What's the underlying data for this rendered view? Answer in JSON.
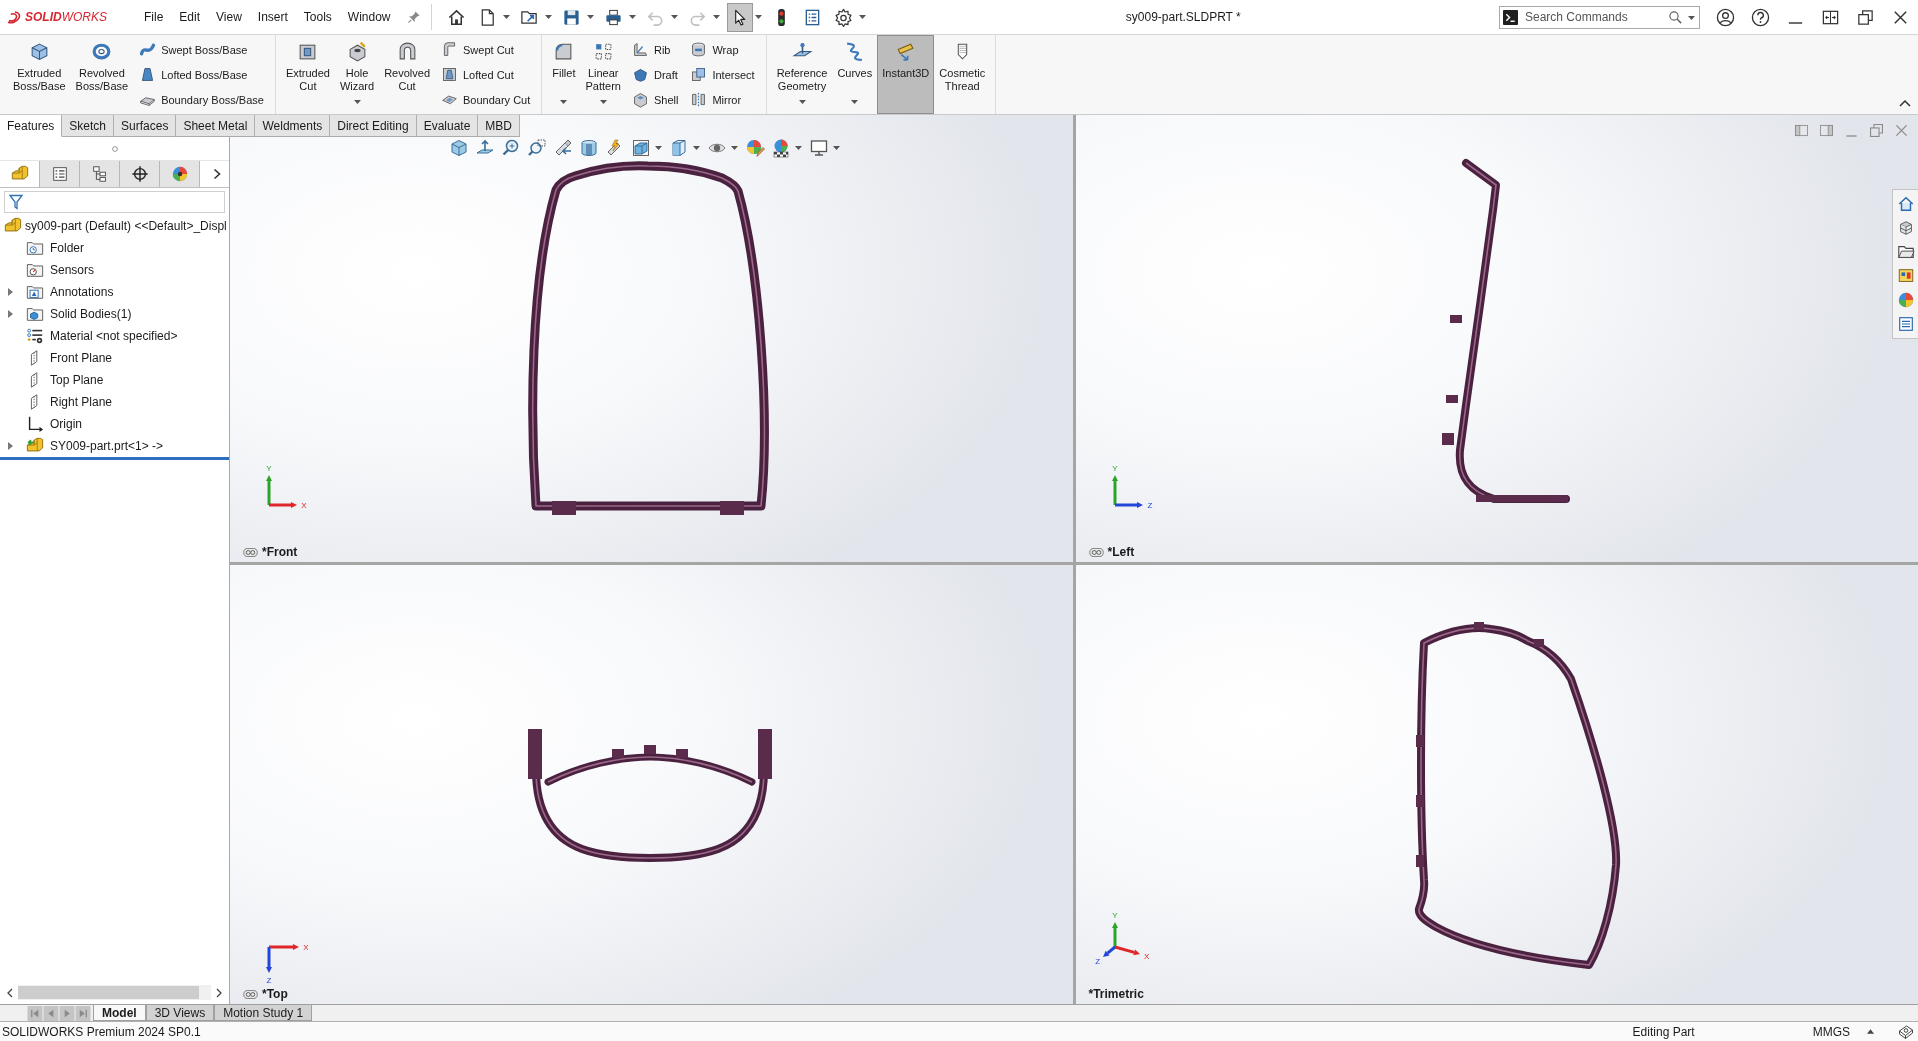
{
  "app": {
    "logo": "**SOLID**WORKS",
    "menu": [
      "File",
      "Edit",
      "View",
      "Insert",
      "Tools",
      "Window"
    ],
    "quick_access": [
      {
        "selected": false,
        "disabled": false,
        "dropdown": false
      },
      {
        "selected": false,
        "disabled": false,
        "dropdown": true
      },
      {
        "selected": false,
        "disabled": false,
        "dropdown": true
      },
      {
        "selected": false,
        "disabled": false,
        "dropdown": true
      },
      {
        "selected": false,
        "disabled": false,
        "dropdown": true
      },
      {
        "selected": false,
        "disabled": true,
        "dropdown": true
      },
      {
        "selected": false,
        "disabled": true,
        "dropdown": true
      },
      {
        "selected": true,
        "disabled": false,
        "dropdown": true
      },
      {
        "selected": false,
        "disabled": false,
        "dropdown": false
      },
      {
        "selected": false,
        "disabled": false,
        "dropdown": false
      },
      {
        "selected": false,
        "disabled": false,
        "dropdown": true
      }
    ],
    "document_title": "sy009-part.SLDPRT *",
    "search": {
      "placeholder": "Search Commands"
    }
  },
  "ribbon": {
    "groups": [
      {
        "columns": [
          {
            "kind": "large",
            "items": [
              {
                "label": "Extruded Boss/Base",
                "dropdown": false,
                "selected": false
              }
            ]
          },
          {
            "kind": "large",
            "items": [
              {
                "label": "Revolved Boss/Base",
                "dropdown": false,
                "selected": false
              }
            ]
          },
          {
            "kind": "stack",
            "items": [
              {
                "label": "Swept Boss/Base",
                "selected": false
              },
              {
                "label": "Lofted Boss/Base",
                "selected": false
              },
              {
                "label": "Boundary Boss/Base",
                "selected": false
              }
            ]
          }
        ]
      },
      {
        "columns": [
          {
            "kind": "large",
            "items": [
              {
                "label": "Extruded Cut",
                "dropdown": false,
                "selected": false
              }
            ]
          },
          {
            "kind": "large",
            "items": [
              {
                "label": "Hole Wizard",
                "dropdown": true,
                "selected": false
              }
            ]
          },
          {
            "kind": "large",
            "items": [
              {
                "label": "Revolved Cut",
                "dropdown": false,
                "selected": false
              }
            ]
          },
          {
            "kind": "stack",
            "items": [
              {
                "label": "Swept Cut",
                "selected": false
              },
              {
                "label": "Lofted Cut",
                "selected": false
              },
              {
                "label": "Boundary Cut",
                "selected": false
              }
            ]
          }
        ]
      },
      {
        "columns": [
          {
            "kind": "large",
            "items": [
              {
                "label": "Fillet",
                "dropdown": true,
                "selected": false
              }
            ]
          },
          {
            "kind": "large",
            "items": [
              {
                "label": "Linear Pattern",
                "dropdown": true,
                "selected": false
              }
            ]
          },
          {
            "kind": "stack",
            "items": [
              {
                "label": "Rib",
                "selected": false
              },
              {
                "label": "Draft",
                "selected": false
              },
              {
                "label": "Shell",
                "selected": false
              }
            ]
          },
          {
            "kind": "stack",
            "items": [
              {
                "label": "Wrap",
                "selected": false
              },
              {
                "label": "Intersect",
                "selected": false
              },
              {
                "label": "Mirror",
                "selected": false
              }
            ]
          }
        ]
      },
      {
        "columns": [
          {
            "kind": "large",
            "items": [
              {
                "label": "Reference Geometry",
                "dropdown": true,
                "selected": false
              }
            ]
          },
          {
            "kind": "large",
            "items": [
              {
                "label": "Curves",
                "dropdown": true,
                "selected": false
              }
            ]
          },
          {
            "kind": "large",
            "items": [
              {
                "label": "Instant3D",
                "dropdown": false,
                "selected": true
              }
            ]
          },
          {
            "kind": "large",
            "items": [
              {
                "label": "Cosmetic Thread",
                "dropdown": false,
                "selected": false
              }
            ]
          }
        ]
      }
    ]
  },
  "command_tabs": [
    {
      "label": "Features",
      "selected": true
    },
    {
      "label": "Sketch",
      "selected": false
    },
    {
      "label": "Surfaces",
      "selected": false
    },
    {
      "label": "Sheet Metal",
      "selected": false
    },
    {
      "label": "Weldments",
      "selected": false
    },
    {
      "label": "Direct Editing",
      "selected": false
    },
    {
      "label": "Evaluate",
      "selected": false
    },
    {
      "label": "MBD",
      "selected": false
    }
  ],
  "feature_manager": {
    "panel_tabs": [
      {
        "selected": true
      },
      {
        "selected": false
      },
      {
        "selected": false
      },
      {
        "selected": false
      },
      {
        "selected": false
      }
    ],
    "tree": {
      "label": "sy009-part (Default) <<Default>_Displ",
      "kind": "part",
      "children": [
        {
          "label": "Folder",
          "kind": "folder",
          "expandable": false,
          "expanded": false
        },
        {
          "label": "Sensors",
          "kind": "sensors",
          "expandable": false,
          "expanded": false
        },
        {
          "label": "Annotations",
          "kind": "annotations",
          "expandable": true,
          "expanded": false
        },
        {
          "label": "Solid Bodies(1)",
          "kind": "bodies",
          "expandable": true,
          "expanded": false
        },
        {
          "label": "Material <not specified>",
          "kind": "material",
          "expandable": false,
          "expanded": false
        },
        {
          "label": "Front Plane",
          "kind": "plane",
          "expandable": false,
          "expanded": false
        },
        {
          "label": "Top Plane",
          "kind": "plane",
          "expandable": false,
          "expanded": false
        },
        {
          "label": "Right Plane",
          "kind": "plane",
          "expandable": false,
          "expanded": false
        },
        {
          "label": "Origin",
          "kind": "origin",
          "expandable": false,
          "expanded": false
        },
        {
          "label": "SY009-part.prt<1> ->",
          "kind": "reference",
          "expandable": true,
          "expanded": false
        }
      ]
    }
  },
  "view_toolbar": [
    {
      "dropdown": false
    },
    {
      "dropdown": false
    },
    {
      "dropdown": false
    },
    {
      "dropdown": false
    },
    {
      "dropdown": false
    },
    {
      "dropdown": false
    },
    {
      "dropdown": false
    },
    {
      "dropdown": true
    },
    {
      "dropdown": true
    },
    {
      "dropdown": true
    },
    {
      "dropdown": false
    },
    {
      "dropdown": true
    },
    {
      "dropdown": true
    }
  ],
  "viewports": [
    {
      "label": "*Front",
      "kind": "front",
      "linked": true,
      "triad": [
        {
          "label": "Y",
          "color": "#2aa52a"
        },
        {
          "label": "X",
          "color": "#e0262a"
        }
      ]
    },
    {
      "label": "*Top",
      "kind": "top",
      "linked": true,
      "triad": [
        {
          "label": "X",
          "color": "#e0262a"
        },
        {
          "label": "Z",
          "color": "#2446d8"
        }
      ]
    },
    {
      "label": "*Left",
      "kind": "left",
      "linked": true,
      "triad": [
        {
          "label": "Y",
          "color": "#2aa52a"
        },
        {
          "label": "Z",
          "color": "#2446d8"
        }
      ]
    },
    {
      "label": "*Trimetric",
      "kind": "trimetric",
      "linked": false,
      "triad": [
        {
          "label": "Y",
          "color": "#2aa52a"
        },
        {
          "label": "X",
          "color": "#e0262a"
        },
        {
          "label": "Z",
          "color": "#2446d8"
        }
      ]
    }
  ],
  "bottom_tabs": [
    {
      "label": "Model",
      "selected": true
    },
    {
      "label": "3D Views",
      "selected": false
    },
    {
      "label": "Motion Study 1",
      "selected": false
    }
  ],
  "status_bar": {
    "product": "SOLIDWORKS Premium 2024 SP0.1",
    "mode": "Editing Part",
    "units": "MMGS"
  }
}
